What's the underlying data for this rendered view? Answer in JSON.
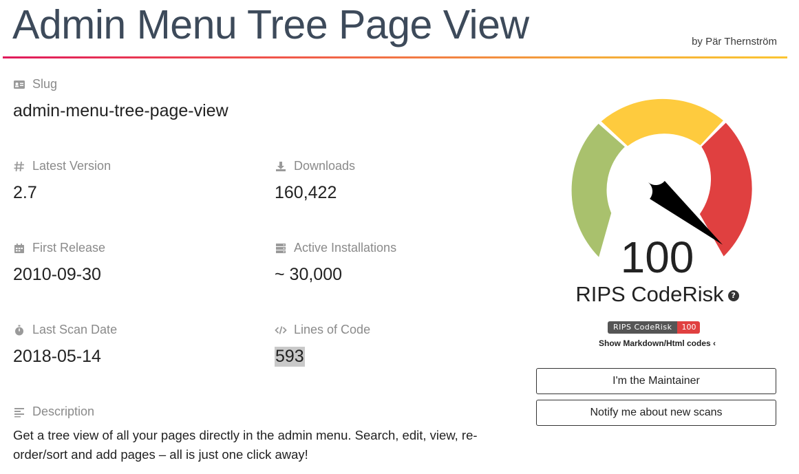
{
  "header": {
    "title": "Admin Menu Tree Page View",
    "byline": "by Pär Thernström"
  },
  "fields": {
    "slug": {
      "label": "Slug",
      "value": "admin-menu-tree-page-view",
      "icon": "id-card-icon"
    },
    "latest_version": {
      "label": "Latest Version",
      "value": "2.7",
      "icon": "hash-icon"
    },
    "downloads": {
      "label": "Downloads",
      "value": "160,422",
      "icon": "download-icon"
    },
    "first_release": {
      "label": "First Release",
      "value": "2010-09-30",
      "icon": "calendar-icon"
    },
    "active_installations": {
      "label": "Active Installations",
      "value": "~ 30,000",
      "icon": "server-icon"
    },
    "last_scan_date": {
      "label": "Last Scan Date",
      "value": "2018-05-14",
      "icon": "stopwatch-icon"
    },
    "lines_of_code": {
      "label": "Lines of Code",
      "value": "593",
      "icon": "code-icon"
    },
    "description": {
      "label": "Description",
      "value": "Get a tree view of all your pages directly in the admin menu. Search, edit, view, re-order/sort and add pages – all is just one click away!",
      "icon": "align-left-icon"
    }
  },
  "gauge": {
    "value": "100",
    "level": 100,
    "caption": "RIPS CodeRisk",
    "colors": {
      "green": "#a9c16d",
      "yellow": "#fecb3e",
      "red": "#e04040",
      "needle": "#000000"
    }
  },
  "badge": {
    "label": "RIPS CodeRisk",
    "value": "100"
  },
  "markdown_link": "Show Markdown/Html codes",
  "buttons": {
    "maintainer": "I'm the Maintainer",
    "notify": "Notify me about new scans"
  }
}
